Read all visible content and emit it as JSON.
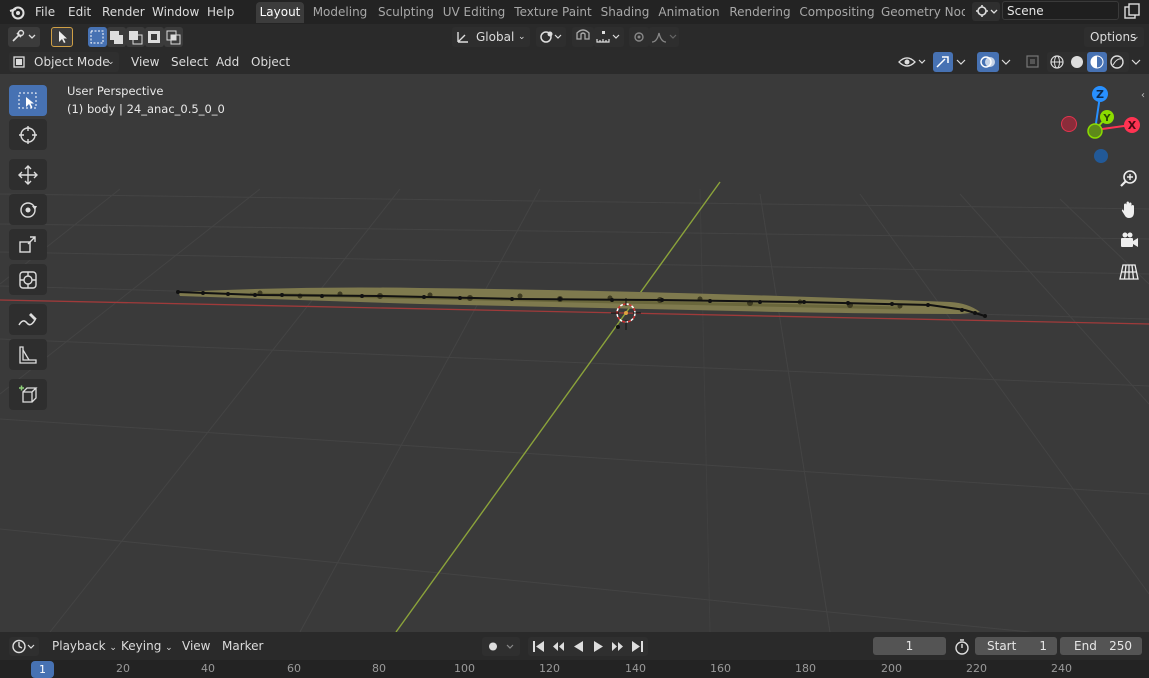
{
  "menu": {
    "items": [
      "File",
      "Edit",
      "Render",
      "Window",
      "Help"
    ]
  },
  "workspaces": [
    "Layout",
    "Modeling",
    "Sculpting",
    "UV Editing",
    "Texture Paint",
    "Shading",
    "Animation",
    "Rendering",
    "Compositing",
    "Geometry Nod"
  ],
  "scene": {
    "value": "Scene"
  },
  "toolheader": {
    "transform_orientation": "Global",
    "options_label": "Options"
  },
  "viewheader": {
    "mode": "Object Mode",
    "menus": [
      "View",
      "Select",
      "Add",
      "Object"
    ]
  },
  "viewport": {
    "perspective_label": "User Perspective",
    "object_label": "(1) body | 24_anac_0.5_0_0",
    "axes": {
      "x": "X",
      "y": "Y",
      "z": "Z"
    },
    "colors": {
      "x_axis": "#ff3352",
      "y_axis": "#8bdc00",
      "z_axis": "#2890ff"
    }
  },
  "timeline": {
    "menus": [
      "Playback",
      "Keying",
      "View",
      "Marker"
    ],
    "current_frame": "1",
    "start_label": "Start",
    "start_value": "1",
    "end_label": "End",
    "end_value": "250",
    "ruler_ticks": [
      "1",
      "20",
      "40",
      "60",
      "80",
      "100",
      "120",
      "140",
      "160",
      "180",
      "200",
      "220",
      "240"
    ]
  }
}
